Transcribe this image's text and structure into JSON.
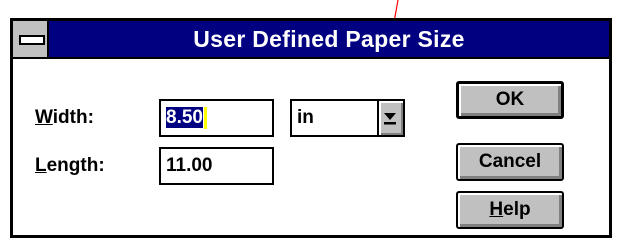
{
  "window": {
    "title": "User Defined Paper Size"
  },
  "fields": {
    "width": {
      "label_mnemonic": "W",
      "label_rest": "idth:",
      "value": "8.50"
    },
    "length": {
      "label_mnemonic": "L",
      "label_rest": "ength:",
      "value": "11.00"
    }
  },
  "units": {
    "selected": "in"
  },
  "buttons": {
    "ok": "OK",
    "cancel": "Cancel",
    "help_mnemonic": "H",
    "help_rest": "elp"
  },
  "colors": {
    "titlebar": "#000080",
    "face": "#c0c0c0",
    "selection": "#000080",
    "caret": "#ffff00",
    "annotation_line": "#ff0000"
  },
  "icons": {
    "system_menu": "system-menu-icon",
    "dropdown": "dropdown-arrow-icon"
  }
}
